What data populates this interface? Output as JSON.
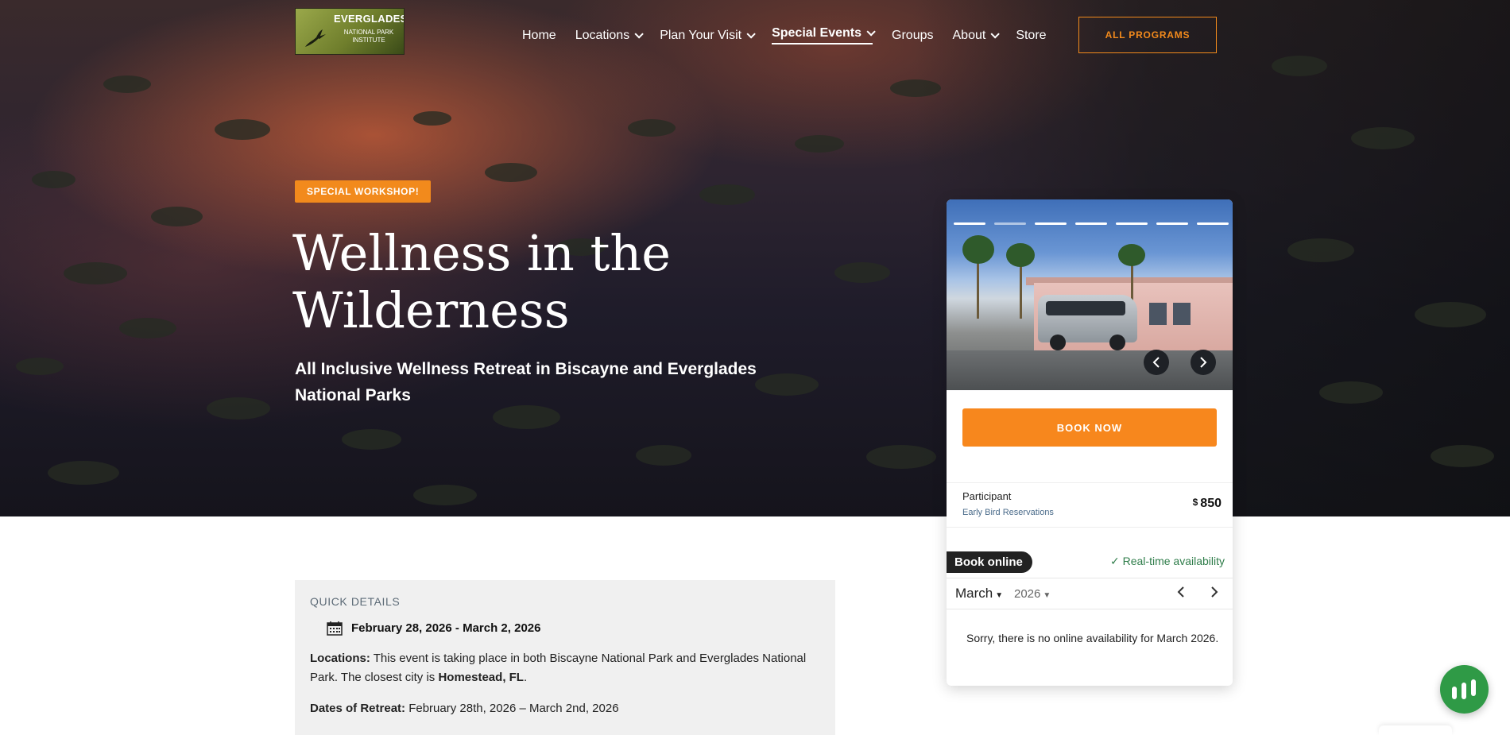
{
  "header": {
    "logo": {
      "line1": "EVERGLADES",
      "line2": "NATIONAL PARK",
      "line3": "INSTITUTE"
    },
    "nav": [
      {
        "label": "Home",
        "dropdown": false
      },
      {
        "label": "Locations",
        "dropdown": true
      },
      {
        "label": "Plan Your Visit",
        "dropdown": true
      },
      {
        "label": "Special Events",
        "dropdown": true,
        "active": true
      },
      {
        "label": "Groups",
        "dropdown": false
      },
      {
        "label": "About",
        "dropdown": true
      },
      {
        "label": "Store",
        "dropdown": false
      }
    ],
    "cta": "ALL PROGRAMS"
  },
  "hero": {
    "badge": "SPECIAL WORKSHOP!",
    "title": "Wellness in the Wilderness",
    "subtitle": "All Inclusive Wellness Retreat in Biscayne and Everglades National Parks"
  },
  "widget": {
    "slides_total": 7,
    "slide_active": 2,
    "prev_icon": "chevron-left-icon",
    "next_icon": "chevron-right-icon",
    "book_now": "BOOK NOW",
    "price": {
      "label": "Participant",
      "sub": "Early Bird Reservations",
      "currency": "$",
      "amount": "850"
    },
    "book_online": "Book online",
    "realtime": "Real-time availability",
    "calendar": {
      "month": "March",
      "year": "2026"
    },
    "no_availability": "Sorry, there is no online availability for March 2026."
  },
  "details": {
    "title": "QUICK DETAILS",
    "dates": "February 28, 2026 - March 2, 2026",
    "locations_label": "Locations:",
    "locations_text": " This event is taking place in both Biscayne National Park and Everglades National Park. The closest city is ",
    "locations_city": "Homestead, FL",
    "locations_end": ".",
    "retreat_label": "Dates of Retreat:",
    "retreat_text": " February 28th, 2026 – March 2nd, 2026"
  },
  "colors": {
    "accent": "#f7871d",
    "green": "#2f9a46",
    "realtime": "#2f7d4a"
  }
}
